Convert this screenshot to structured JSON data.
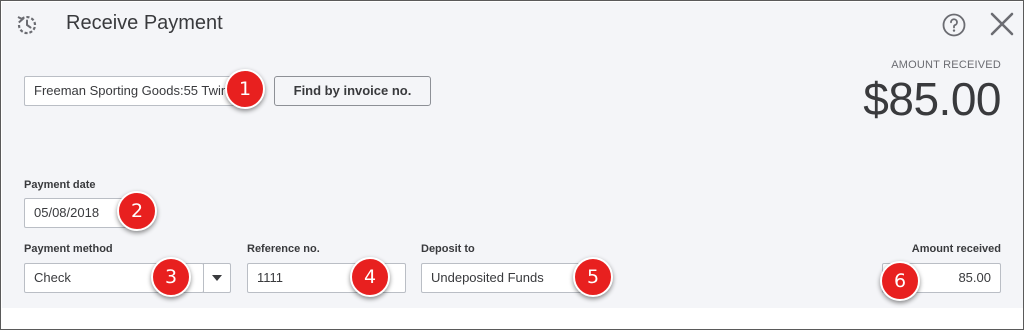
{
  "header": {
    "title": "Receive Payment",
    "history_icon": "history-icon",
    "help_icon": "help-icon",
    "close_icon": "close-icon"
  },
  "amount_summary": {
    "label": "AMOUNT RECEIVED",
    "value": "$85.00"
  },
  "customer": {
    "value": "Freeman Sporting Goods:55 Twin"
  },
  "find_invoice_button": {
    "label": "Find by invoice no."
  },
  "payment_date": {
    "label": "Payment date",
    "value": "05/08/2018"
  },
  "payment_method": {
    "label": "Payment method",
    "value": "Check"
  },
  "reference": {
    "label": "Reference no.",
    "value": "1111"
  },
  "deposit_to": {
    "label": "Deposit to",
    "value": "Undeposited Funds"
  },
  "amount_received": {
    "label": "Amount received",
    "value": "85.00"
  },
  "callouts": [
    "1",
    "2",
    "3",
    "4",
    "5",
    "6"
  ],
  "colors": {
    "callout": "#e8201f",
    "panel_background": "#f4f5f8",
    "text": "#393a3d"
  }
}
